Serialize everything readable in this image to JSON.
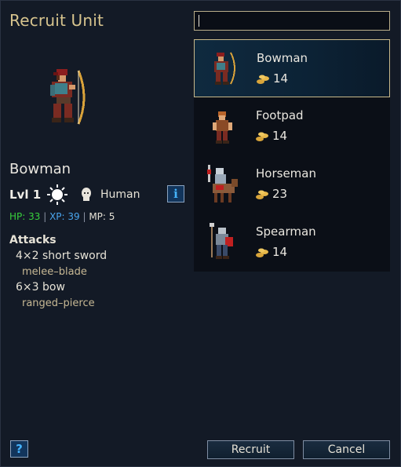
{
  "window": {
    "title": "Recruit Unit"
  },
  "preview": {
    "unit_name": "Bowman",
    "level": "Lvl 1",
    "alignment_icon": "sun-icon",
    "race_icon": "human-head-icon",
    "race": "Human",
    "info_button": "i",
    "hp": "HP: 33",
    "xp": "XP: 39",
    "mp": "MP: 5",
    "separator": " | ",
    "attacks_title": "Attacks",
    "attacks": [
      {
        "name": "4×2 short sword",
        "type": "melee–blade"
      },
      {
        "name": "6×3 bow",
        "type": "ranged–pierce"
      }
    ]
  },
  "search": {
    "value": "",
    "placeholder": ""
  },
  "units": [
    {
      "name": "Bowman",
      "cost": "14",
      "selected": true
    },
    {
      "name": "Footpad",
      "cost": "14",
      "selected": false
    },
    {
      "name": "Horseman",
      "cost": "23",
      "selected": false
    },
    {
      "name": "Spearman",
      "cost": "14",
      "selected": false
    }
  ],
  "buttons": {
    "help": "?",
    "recruit": "Recruit",
    "cancel": "Cancel"
  },
  "colors": {
    "hp": "#38d03c",
    "xp": "#4aa6ee",
    "title": "#d7c48e",
    "selection_border": "#c8b98a"
  }
}
